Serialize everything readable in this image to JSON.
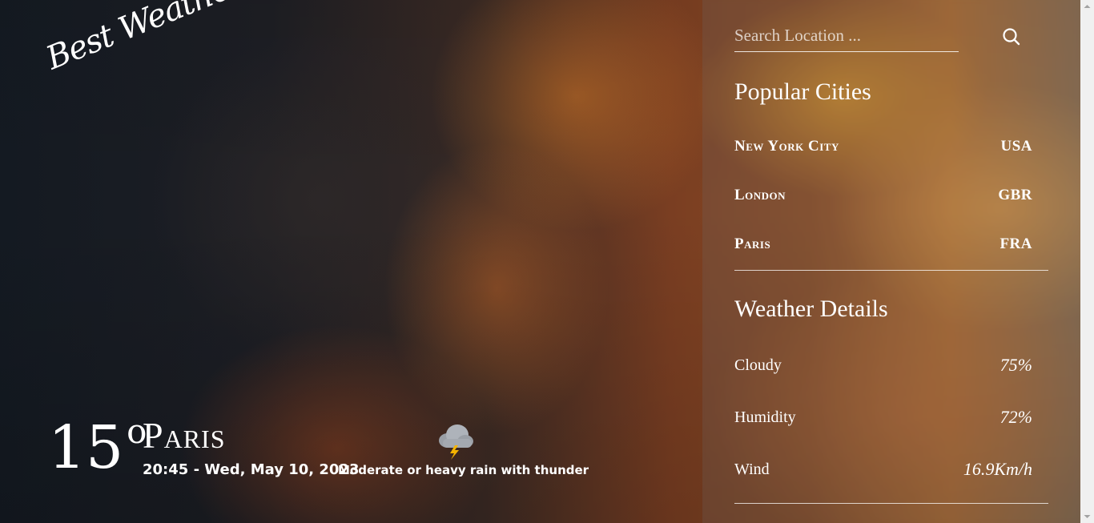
{
  "app": {
    "logo_text": "Best Weather App"
  },
  "current": {
    "temperature": "15",
    "degree_symbol": "o",
    "city": "Paris",
    "datetime": "20:45 - Wed, May 10, 2023",
    "condition_text": "Moderate or heavy rain with thunder",
    "condition_icon": "thunderstorm-cloud-icon"
  },
  "search": {
    "placeholder": "Search Location ...",
    "value": "",
    "button_icon": "search-icon"
  },
  "popular": {
    "title": "Popular Cities",
    "cities": [
      {
        "name": "New York City",
        "country": "USA"
      },
      {
        "name": "London",
        "country": "GBR"
      },
      {
        "name": "Paris",
        "country": "FRA"
      }
    ]
  },
  "details": {
    "title": "Weather Details",
    "items": [
      {
        "label": "Cloudy",
        "value": "75%"
      },
      {
        "label": "Humidity",
        "value": "72%"
      },
      {
        "label": "Wind",
        "value": "16.9Km/h"
      }
    ]
  },
  "colors": {
    "text": "#ffffff",
    "panel_overlay": "rgba(110,110,110,0.22)",
    "lightning": "#f5b400"
  }
}
